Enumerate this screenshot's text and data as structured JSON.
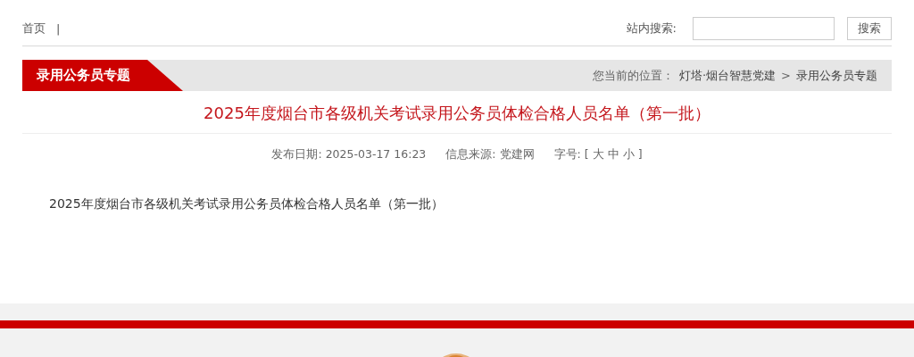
{
  "top_nav": {
    "links": [
      "首页"
    ],
    "separator": "|"
  },
  "search": {
    "label": "站内搜索:",
    "button": "搜索"
  },
  "banner": {
    "title": "录用公务员专题",
    "location_label": "您当前的位置：",
    "breadcrumbs": [
      "灯塔·烟台智慧党建",
      "录用公务员专题"
    ],
    "breadcrumb_separator": ">"
  },
  "article": {
    "title": "2025年度烟台市各级机关考试录用公务员体检合格人员名单（第一批）",
    "meta": [
      {
        "label": "发布日期:",
        "value": "2025-03-17 16:23"
      },
      {
        "label": "信息来源:",
        "value": "党建网"
      }
    ],
    "font_size": {
      "label": "字号:",
      "open": "[",
      "options": [
        "大",
        "中",
        "小"
      ],
      "close": "]"
    },
    "body": "2025年度烟台市各级机关考试录用公务员体检合格人员名单（第一批）"
  }
}
